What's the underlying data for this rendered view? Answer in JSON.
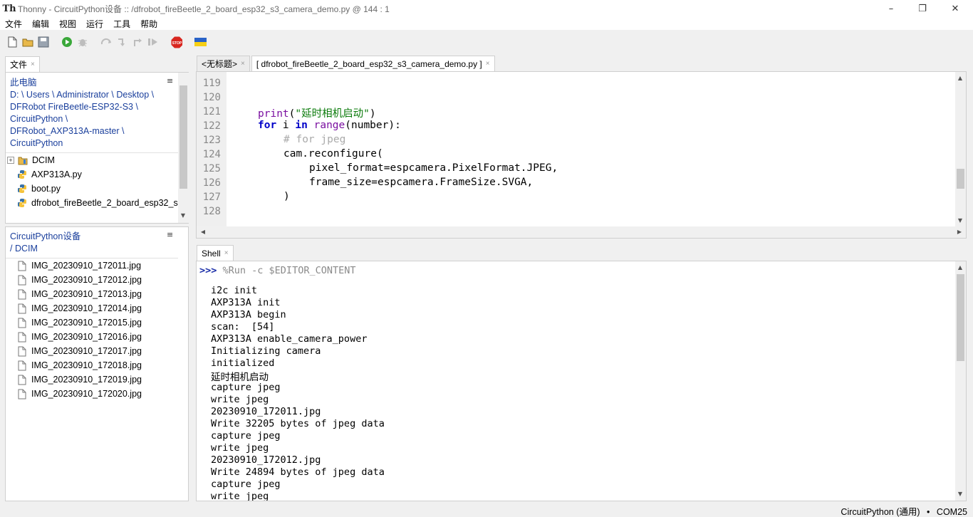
{
  "window": {
    "app_name": "Thonny",
    "title": "Thonny  -  CircuitPython设备 :: /dfrobot_fireBeetle_2_board_esp32_s3_camera_demo.py  @  144 : 1",
    "minimize": "–",
    "maximize": "❐",
    "close": "✕"
  },
  "menu": [
    "文件",
    "编辑",
    "视图",
    "运行",
    "工具",
    "帮助"
  ],
  "toolbar": {
    "icons": [
      "new-file-icon",
      "open-file-icon",
      "save-icon",
      "run-icon",
      "debug-icon",
      "step-over-icon",
      "step-into-icon",
      "step-out-icon",
      "resume-icon",
      "stop-icon",
      "ukraine-flag-icon"
    ],
    "stop_label": "STOP"
  },
  "files_panel": {
    "tab_label": "文件",
    "tab_close": "×",
    "menu_icon": "≡",
    "computer": {
      "heading": "此电脑",
      "path_lines": [
        "D: \\ Users \\ Administrator \\ Desktop \\",
        "DFRobot FireBeetle-ESP32-S3 \\",
        "CircuitPython \\",
        "DFRobot_AXP313A-master \\",
        "CircuitPython"
      ],
      "items": [
        {
          "name": "DCIM",
          "type": "folder",
          "expander": "+"
        },
        {
          "name": "AXP313A.py",
          "type": "python"
        },
        {
          "name": "boot.py",
          "type": "python"
        },
        {
          "name": "dfrobot_fireBeetle_2_board_esp32_s",
          "type": "python"
        }
      ]
    },
    "device": {
      "heading": "CircuitPython设备",
      "path": "/ DCIM",
      "files": [
        "IMG_20230910_172011.jpg",
        "IMG_20230910_172012.jpg",
        "IMG_20230910_172013.jpg",
        "IMG_20230910_172014.jpg",
        "IMG_20230910_172015.jpg",
        "IMG_20230910_172016.jpg",
        "IMG_20230910_172017.jpg",
        "IMG_20230910_172018.jpg",
        "IMG_20230910_172019.jpg",
        "IMG_20230910_172020.jpg"
      ]
    }
  },
  "editor": {
    "tabs": [
      {
        "label": "<无标题>",
        "close": "×",
        "active": false
      },
      {
        "label": "[ dfrobot_fireBeetle_2_board_esp32_s3_camera_demo.py ]",
        "close": "×",
        "active": true
      }
    ],
    "line_numbers": [
      "119",
      "120",
      "121",
      "122",
      "123",
      "124",
      "125",
      "126",
      "127",
      "128"
    ],
    "code": {
      "l121_fn": "print",
      "l121_open": "(",
      "l121_str": "\"延时相机启动\"",
      "l121_close": ")",
      "l122_for": "for",
      "l122_i": " i ",
      "l122_in": "in",
      "l122_range": "range",
      "l122_rest": "(number):",
      "l123": "# for jpeg",
      "l124": "cam.reconfigure(",
      "l125": "pixel_format=espcamera.PixelFormat.JPEG,",
      "l126": "frame_size=espcamera.FrameSize.SVGA,",
      "l127": ")"
    }
  },
  "shell": {
    "tab_label": "Shell",
    "tab_close": "×",
    "prompt": ">>>",
    "command": "%Run -c $EDITOR_CONTENT",
    "output": [
      "i2c init",
      "AXP313A init",
      "AXP313A begin",
      "scan:  [54]",
      "AXP313A enable_camera_power",
      "Initializing camera",
      "initialized",
      "延时相机启动",
      "capture jpeg",
      "write jpeg",
      "20230910_172011.jpg",
      "Write 32205 bytes of jpeg data",
      "capture jpeg",
      "write jpeg",
      "20230910_172012.jpg",
      "Write 24894 bytes of jpeg data",
      "capture jpeg",
      "write jpeg"
    ]
  },
  "status": {
    "interpreter": "CircuitPython (通用)",
    "separator": "•",
    "port": "COM25"
  },
  "colors": {
    "keyword": "#0000c8",
    "builtin": "#7a0fa0",
    "string": "#0a7a0a",
    "comment": "#aaaaaa",
    "path_link": "#1a3f9c"
  }
}
